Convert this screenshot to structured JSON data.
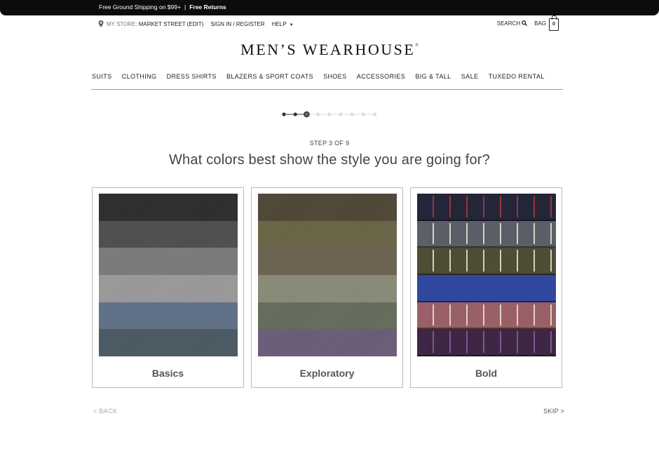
{
  "promo": {
    "shipping": "Free Ground Shipping on $99+",
    "separator": "|",
    "returns": "Free Returns"
  },
  "utility": {
    "store_prefix": "My Store:",
    "store_name": "Market Street (Edit)",
    "sign_in": "Sign In / Register",
    "help": "Help",
    "search": "Search",
    "bag": "Bag",
    "bag_count": "0"
  },
  "logo": {
    "name": "MEN’S WEARHOUSE",
    "mark": "®"
  },
  "nav": {
    "items": [
      "SUITS",
      "CLOTHING",
      "DRESS SHIRTS",
      "BLAZERS & SPORT COATS",
      "SHOES",
      "ACCESSORIES",
      "BIG & TALL",
      "SALE",
      "TUXEDO RENTAL"
    ]
  },
  "progress": {
    "current_step": 3,
    "total_steps": 9
  },
  "quiz": {
    "step_label": "STEP 3 OF 9",
    "question": "What colors best show the style you are going for?",
    "options": [
      {
        "label": "Basics",
        "swatch_colors": [
          "#2b2b2b",
          "#4d4d4d",
          "#7a7a7a",
          "#9a9a9a",
          "#5e7088",
          "#4a5862"
        ]
      },
      {
        "label": "Exploratory",
        "swatch_colors": [
          "#4e4536",
          "#6a6444",
          "#6b6150",
          "#8a8a78",
          "#646c5c",
          "#6a5c78"
        ]
      },
      {
        "label": "Bold",
        "swatch_colors": [
          "#1f2236",
          "#5a5d66",
          "#4c4a30",
          "#2c45a0",
          "#9a5e66",
          "#3a2240"
        ]
      }
    ]
  },
  "footer_nav": {
    "back": "< BACK",
    "skip": "SKIP >"
  },
  "colors": {
    "promo_bar": "#0c0c0c",
    "text": "#333333",
    "border": "#bbbbbb"
  }
}
